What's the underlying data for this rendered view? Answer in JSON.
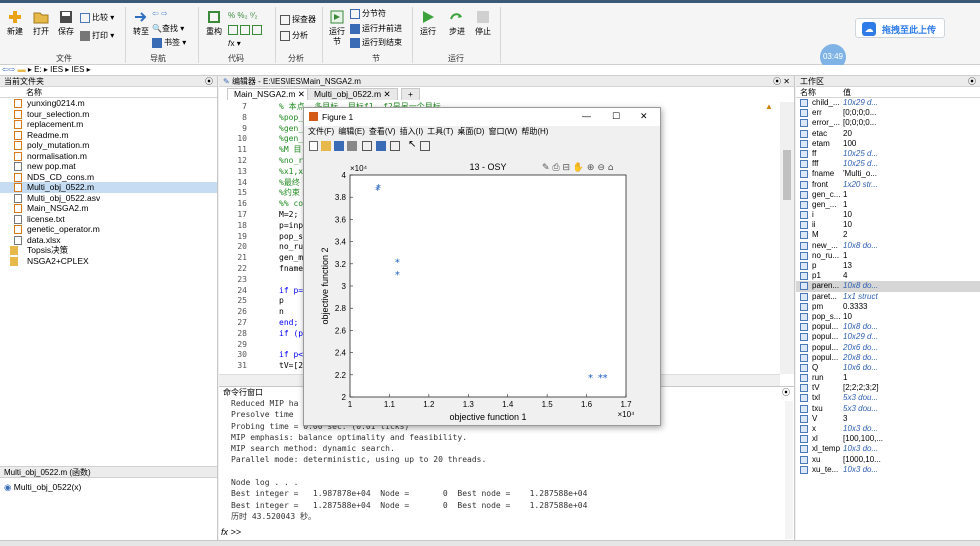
{
  "ribbon": {
    "file_buttons": [
      "新建",
      "打开",
      "保存"
    ],
    "compare_label": "比较 ▾",
    "print_label": "打印 ▾",
    "goto_label": "转至",
    "find_label": "查找 ▾",
    "bookmark_label": "书签 ▾",
    "refactor_label": "重构",
    "analyzer_label": "探查器",
    "analyze_label": "分析",
    "run_section_label": "运行\n节",
    "section_break_label": "分节符",
    "run_advance_label": "运行并前进",
    "run_to_end_label": "运行到结束",
    "run_label": "运行",
    "step_label": "步进",
    "stop_label": "停止",
    "groups": [
      "文件",
      "导航",
      "代码",
      "分析",
      "节",
      "运行"
    ],
    "upload_label": "拖拽至此上传",
    "clock": "03:49"
  },
  "address": {
    "path": [
      "E:",
      "IES",
      "IES"
    ]
  },
  "left_panel": {
    "title": "当前文件夹",
    "column": "名称",
    "files": [
      {
        "name": "yunxing0214.m",
        "type": "m"
      },
      {
        "name": "tour_selection.m",
        "type": "m"
      },
      {
        "name": "replacement.m",
        "type": "m"
      },
      {
        "name": "Readme.m",
        "type": "m"
      },
      {
        "name": "poly_mutation.m",
        "type": "m"
      },
      {
        "name": "normalisation.m",
        "type": "m"
      },
      {
        "name": "new pop.mat",
        "type": "mat"
      },
      {
        "name": "NDS_CD_cons.m",
        "type": "m"
      },
      {
        "name": "Multi_obj_0522.m",
        "type": "m",
        "selected": true
      },
      {
        "name": "Multi_obj_0522.asv",
        "type": "asv"
      },
      {
        "name": "Main_NSGA2.m",
        "type": "m"
      },
      {
        "name": "license.txt",
        "type": "txt"
      },
      {
        "name": "genetic_operator.m",
        "type": "m"
      },
      {
        "name": "data.xlsx",
        "type": "xlsx"
      },
      {
        "name": "Topsis决策",
        "type": "folder"
      },
      {
        "name": "NSGA2+CPLEX",
        "type": "folder"
      }
    ],
    "detail_title": "Multi_obj_0522.m (函数)",
    "detail_item": "Multi_obj_0522(x)"
  },
  "editor": {
    "title": "编辑器 - E:\\IES\\IES\\Main_NSGA2.m",
    "tabs": [
      "Main_NSGA2.m",
      "Multi_obj_0522.m"
    ],
    "add_tab": "+",
    "lines": [
      {
        "n": "7",
        "t": "% 本点……多目标……目标f1, f2是另一个目标",
        "c": "com"
      },
      {
        "n": "8",
        "t": "%pop_",
        "c": "com"
      },
      {
        "n": "9",
        "t": "%gen_",
        "c": "com"
      },
      {
        "n": "10",
        "t": "%gen_",
        "c": "com"
      },
      {
        "n": "11",
        "t": "%M 目",
        "c": "com"
      },
      {
        "n": "12",
        "t": "%no_r",
        "c": "com"
      },
      {
        "n": "13",
        "t": "%x1,x",
        "c": "com"
      },
      {
        "n": "14",
        "t": "%最终",
        "c": "com"
      },
      {
        "n": "15",
        "t": "%约束",
        "c": "com"
      },
      {
        "n": "16",
        "t": "%% co",
        "c": "com"
      },
      {
        "n": "17",
        "t": "M=2;",
        "c": ""
      },
      {
        "n": "18",
        "t": "p=inp",
        "c": ""
      },
      {
        "n": "19",
        "t": "pop_s",
        "c": ""
      },
      {
        "n": "20",
        "t": "no_ru",
        "c": ""
      },
      {
        "n": "21",
        "t": "gen_m",
        "c": ""
      },
      {
        "n": "22",
        "t": "fname",
        "c": ""
      },
      {
        "n": "23",
        "t": "",
        "c": ""
      },
      {
        "n": "24",
        "t": "if p=",
        "c": "kw"
      },
      {
        "n": "25",
        "t": "    p",
        "c": ""
      },
      {
        "n": "26",
        "t": "    n",
        "c": ""
      },
      {
        "n": "27",
        "t": "end;",
        "c": "kw"
      },
      {
        "n": "28",
        "t": "if (p",
        "c": "kw"
      },
      {
        "n": "29",
        "t": "",
        "c": ""
      },
      {
        "n": "30",
        "t": "if p<",
        "c": "kw"
      },
      {
        "n": "31",
        "t": "tV=[2",
        "c": ""
      }
    ]
  },
  "command": {
    "title": "命令行窗口",
    "lines": [
      "Reduced MIP ha",
      "Presolve time",
      "Probing time = 0.00 sec. (0.01 ticks)",
      "MIP emphasis: balance optimality and feasibility.",
      "MIP search method: dynamic search.",
      "Parallel mode: deterministic, using up to 20 threads.",
      "",
      "Node log . . .",
      "Best integer =   1.987878e+04  Node =       0  Best node =    1.287588e+04",
      "Best integer =   1.287588e+04  Node =       0  Best node =    1.287588e+04",
      "历时 43.520043 秒。"
    ],
    "prompt": "fx >>"
  },
  "workspace": {
    "title": "工作区",
    "col_name": "名称",
    "col_value": "值",
    "vars": [
      {
        "n": "child_...",
        "v": "10x29 d...",
        "i": true
      },
      {
        "n": "err",
        "v": "[0;0;0;0...",
        "i": false
      },
      {
        "n": "error_...",
        "v": "[0;0;0;0...",
        "i": false
      },
      {
        "n": "etac",
        "v": "20",
        "i": false
      },
      {
        "n": "etam",
        "v": "100",
        "i": false
      },
      {
        "n": "ff",
        "v": "10x25 d...",
        "i": true
      },
      {
        "n": "fff",
        "v": "10x25 d...",
        "i": true
      },
      {
        "n": "fname",
        "v": "'Multi_o...",
        "i": false
      },
      {
        "n": "front",
        "v": "1x20 str...",
        "i": true
      },
      {
        "n": "gen_c...",
        "v": "1",
        "i": false
      },
      {
        "n": "gen_...",
        "v": "1",
        "i": false
      },
      {
        "n": "i",
        "v": "10",
        "i": false
      },
      {
        "n": "ii",
        "v": "10",
        "i": false
      },
      {
        "n": "M",
        "v": "2",
        "i": false
      },
      {
        "n": "new_...",
        "v": "10x8 do...",
        "i": true
      },
      {
        "n": "no_ru...",
        "v": "1",
        "i": false
      },
      {
        "n": "p",
        "v": "13",
        "i": false
      },
      {
        "n": "p1",
        "v": "4",
        "i": false
      },
      {
        "n": "paren...",
        "v": "10x8 do...",
        "i": true,
        "sel": true
      },
      {
        "n": "paret...",
        "v": "1x1 struct",
        "i": true
      },
      {
        "n": "pm",
        "v": "0.3333",
        "i": false
      },
      {
        "n": "pop_s...",
        "v": "10",
        "i": false
      },
      {
        "n": "popul...",
        "v": "10x8 do...",
        "i": true
      },
      {
        "n": "popul...",
        "v": "10x29 d...",
        "i": true
      },
      {
        "n": "popul...",
        "v": "20x6 do...",
        "i": true
      },
      {
        "n": "popul...",
        "v": "20x8 do...",
        "i": true
      },
      {
        "n": "Q",
        "v": "10x6 do...",
        "i": true
      },
      {
        "n": "run",
        "v": "1",
        "i": false
      },
      {
        "n": "tV",
        "v": "[2;2;2;3;2]",
        "i": false
      },
      {
        "n": "txl",
        "v": "5x3 dou...",
        "i": true
      },
      {
        "n": "txu",
        "v": "5x3 dou...",
        "i": true
      },
      {
        "n": "V",
        "v": "3",
        "i": false
      },
      {
        "n": "x",
        "v": "10x3 do...",
        "i": true
      },
      {
        "n": "xl",
        "v": "[100,100,...",
        "i": false
      },
      {
        "n": "xl_temp",
        "v": "10x3 do...",
        "i": true
      },
      {
        "n": "xu",
        "v": "[1000,10...",
        "i": false
      },
      {
        "n": "xu_te...",
        "v": "10x3 do...",
        "i": true
      }
    ]
  },
  "figure": {
    "window_title": "Figure 1",
    "menu": [
      "文件(F)",
      "编辑(E)",
      "查看(V)",
      "插入(I)",
      "工具(T)",
      "桌面(D)",
      "窗口(W)",
      "帮助(H)"
    ],
    "min": "—",
    "max": "☐",
    "close": "✕"
  },
  "chart_data": {
    "type": "scatter",
    "title": "13 - OSY",
    "xlabel": "objective function 1",
    "ylabel": "objective function 2",
    "x_exponent": "×10⁴",
    "y_exponent": "×10⁴",
    "xlim": [
      1,
      1.7
    ],
    "ylim": [
      2,
      4
    ],
    "xticks": [
      "1",
      "1.1",
      "1.2",
      "1.3",
      "1.4",
      "1.5",
      "1.6",
      "1.7"
    ],
    "yticks": [
      "2",
      "2.2",
      "2.4",
      "2.6",
      "2.8",
      "3",
      "3.2",
      "3.4",
      "3.6",
      "3.8",
      "4"
    ],
    "marker": "*",
    "color": "#1f5fbf",
    "points": [
      {
        "x": 1.07,
        "y": 3.87
      },
      {
        "x": 1.072,
        "y": 3.89
      },
      {
        "x": 1.12,
        "y": 3.22
      },
      {
        "x": 1.12,
        "y": 3.11
      },
      {
        "x": 1.61,
        "y": 2.18
      },
      {
        "x": 1.635,
        "y": 2.18
      },
      {
        "x": 1.647,
        "y": 2.18
      }
    ]
  }
}
